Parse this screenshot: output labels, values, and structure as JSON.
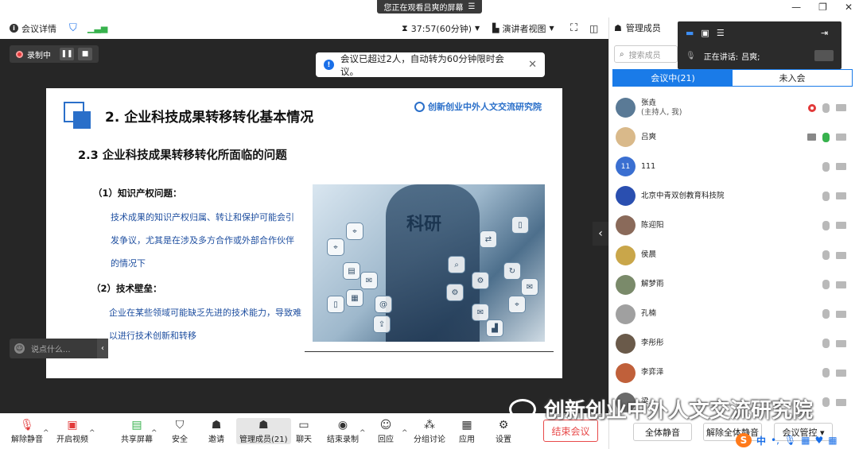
{
  "banner": {
    "text": "您正在观看吕爽的屏幕",
    "menu_icon": "menu-icon"
  },
  "window_controls": {
    "minimize": "—",
    "restore": "❐",
    "close": "✕"
  },
  "topbar": {
    "meeting_details": "会议详情",
    "timer": "37:57(60分钟)",
    "view_label": "演讲者视图"
  },
  "recording": {
    "label": "录制中",
    "pause": "❚❚",
    "stop": "■"
  },
  "toast": {
    "text": "会议已超过2人，自动转为60分钟限时会议。",
    "close": "✕"
  },
  "slide": {
    "title": "2. 企业科技成果转移转化基本情况",
    "logo_text": "创新创业中外人文交流研究院",
    "subtitle": "2.3 企业科技成果转移转化所面临的问题",
    "heading1": "（1）知识产权问题：",
    "para1": "技术成果的知识产权归属、转让和保护可能会引发争议，尤其是在涉及多方合作或外部合作伙伴的情况下",
    "heading2": "（2）技术壁垒：",
    "para2": "企业在某些领域可能缺乏先进的技术能力，导致难以进行技术创新和转移",
    "photo_word": "科研"
  },
  "chat": {
    "placeholder": "说点什么..."
  },
  "bottombar": {
    "unmute": "解除静音",
    "video": "开启视频",
    "share": "共享屏幕",
    "security": "安全",
    "invite": "邀请",
    "members": "管理成员(21)",
    "chat": "聊天",
    "end_record": "结束录制",
    "react": "回应",
    "breakout": "分组讨论",
    "apps": "应用",
    "settings": "设置",
    "end_meeting": "结束会议"
  },
  "panel": {
    "title": "管理成员",
    "speaking_label": "正在讲话:",
    "speaking_name": "吕爽;",
    "search_placeholder": "搜索成员",
    "tab_in": "会议中(21)",
    "tab_out": "未入会",
    "mute_all": "全体静音",
    "unmute_all": "解除全体静音",
    "meeting_control": "会议管控 ▾",
    "members": [
      {
        "name": "张垚",
        "role": "(主持人, 我)",
        "avatar_color": "#5a7a96",
        "initial": "",
        "rec": true,
        "mic_on": false,
        "screen": false
      },
      {
        "name": "吕爽",
        "role": "",
        "avatar_color": "#d9b98a",
        "initial": "",
        "rec": false,
        "mic_on": true,
        "screen": true
      },
      {
        "name": "111",
        "role": "",
        "avatar_color": "#3a6fd1",
        "initial": "11",
        "rec": false,
        "mic_on": false,
        "screen": false
      },
      {
        "name": "北京中青双创教育科技院",
        "role": "",
        "avatar_color": "#2a4fb0",
        "initial": "",
        "rec": false,
        "mic_on": false,
        "screen": false
      },
      {
        "name": "陈迎阳",
        "role": "",
        "avatar_color": "#8a6a5a",
        "initial": "",
        "rec": false,
        "mic_on": false,
        "screen": false
      },
      {
        "name": "侯晨",
        "role": "",
        "avatar_color": "#c9a64a",
        "initial": "",
        "rec": false,
        "mic_on": false,
        "screen": false
      },
      {
        "name": "解梦雨",
        "role": "",
        "avatar_color": "#7a8a6a",
        "initial": "",
        "rec": false,
        "mic_on": false,
        "screen": false
      },
      {
        "name": "孔楠",
        "role": "",
        "avatar_color": "#a0a0a0",
        "initial": "",
        "rec": false,
        "mic_on": false,
        "screen": false
      },
      {
        "name": "李彤彤",
        "role": "",
        "avatar_color": "#6a5a4a",
        "initial": "",
        "rec": false,
        "mic_on": false,
        "screen": false
      },
      {
        "name": "李弈泽",
        "role": "",
        "avatar_color": "#c0603a",
        "initial": "",
        "rec": false,
        "mic_on": false,
        "screen": false
      },
      {
        "name": "梁...",
        "role": "",
        "avatar_color": "#6a6a6a",
        "initial": "",
        "rec": false,
        "mic_on": false,
        "screen": false
      }
    ]
  },
  "watermark": {
    "text": "创新创业中外人文交流研究院"
  },
  "ime": {
    "logo": "S",
    "lang": "中"
  }
}
